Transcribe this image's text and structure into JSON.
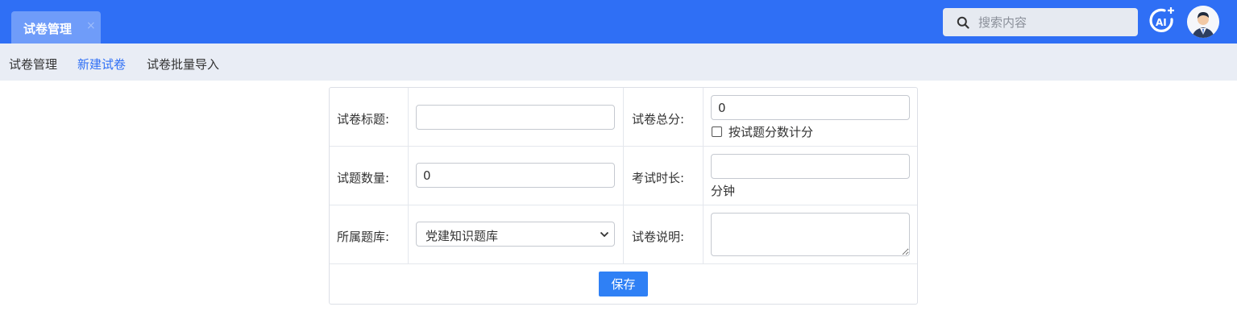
{
  "header": {
    "tab": {
      "label": "试卷管理",
      "close": "×"
    },
    "search": {
      "placeholder": "搜索内容"
    }
  },
  "subnav": {
    "items": [
      {
        "label": "试卷管理",
        "active": false
      },
      {
        "label": "新建试卷",
        "active": true
      },
      {
        "label": "试卷批量导入",
        "active": false
      }
    ]
  },
  "form": {
    "title": {
      "label": "试卷标题:",
      "value": ""
    },
    "total_score": {
      "label": "试卷总分:",
      "value": "0",
      "checkbox_label": "按试题分数计分",
      "checked": false
    },
    "question_count": {
      "label": "试题数量:",
      "value": "0"
    },
    "duration": {
      "label": "考试时长:",
      "value": "",
      "unit": "分钟"
    },
    "bank": {
      "label": "所属题库:",
      "selected": "党建知识题库"
    },
    "description": {
      "label": "试卷说明:",
      "value": ""
    },
    "save_label": "保存"
  },
  "colors": {
    "header_bg": "#2f6ff5",
    "tab_bg": "#6f9cf9",
    "subnav_bg": "#e9edf5",
    "active_link": "#2f6ff5",
    "primary_button": "#2f80f5"
  }
}
